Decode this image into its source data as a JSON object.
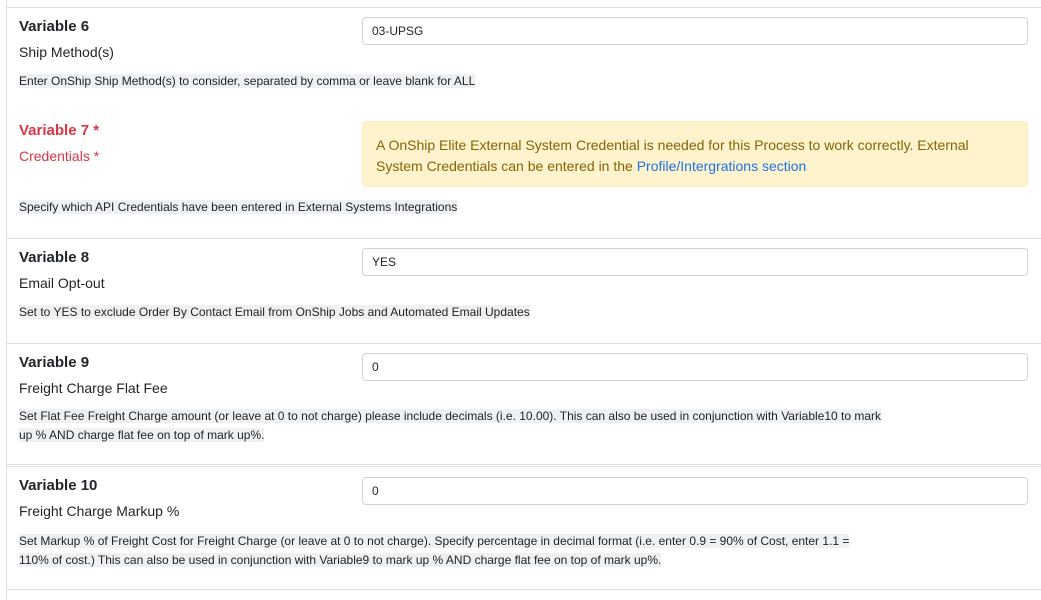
{
  "variables": [
    {
      "title": "Variable 6",
      "subtitle": "Ship Method(s)",
      "value": "03-UPSG",
      "help": [
        "Enter OnShip Ship Method(s) to consider, separated by comma or leave blank for ALL"
      ]
    },
    {
      "title": "Variable 7",
      "required_marker": "*",
      "subtitle": "Credentials",
      "alert": {
        "text_before": "A OnShip Elite External System Credential is needed for this Process to work correctly. External System Credentials can be entered in the ",
        "link_text": "Profile/Intergrations section"
      },
      "help": [
        "Specify which API Credentials have been entered in External Systems Integrations"
      ]
    },
    {
      "title": "Variable 8",
      "subtitle": "Email Opt-out",
      "value": "YES",
      "help": [
        "Set to YES to exclude Order By Contact Email from OnShip Jobs and Automated Email Updates"
      ]
    },
    {
      "title": "Variable 9",
      "subtitle": "Freight Charge Flat Fee",
      "value": "0",
      "help": [
        "Set Flat Fee Freight Charge amount (or leave at 0 to not charge) please include decimals (i.e. 10.00). This can also be used in conjunction with Variable10 to mark",
        "up % AND charge flat fee on top of mark up%. "
      ]
    },
    {
      "title": "Variable 10",
      "subtitle": "Freight Charge Markup %",
      "value": "0",
      "help": [
        "Set Markup % of Freight Cost for Freight Charge (or leave at 0 to not charge).  Specify percentage in decimal format (i.e. enter 0.9 = 90% of Cost,  enter 1.1 =",
        "110% of cost.) This can also be used in conjunction with Variable9 to mark up % AND charge flat fee on top of mark up%."
      ]
    }
  ],
  "colors": {
    "required": "#dc3545",
    "alert_bg": "#fff3cd",
    "alert_text": "#856404",
    "link": "#1a73e8"
  }
}
